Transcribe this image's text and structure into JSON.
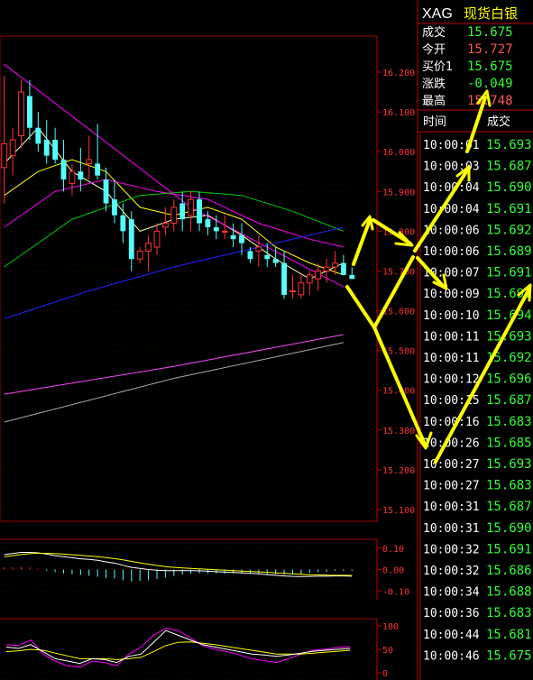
{
  "instrument": {
    "code": "XAG",
    "name": "现货白银"
  },
  "quote": [
    {
      "label": "成交",
      "value": "15.675",
      "color": "#33ff33"
    },
    {
      "label": "今开",
      "value": "15.727",
      "color": "#ff5555"
    },
    {
      "label": "买价1",
      "value": "15.675",
      "color": "#33ff33"
    },
    {
      "label": "涨跌",
      "value": "-0.049",
      "color": "#33ff33"
    },
    {
      "label": "最高",
      "value": "15.748",
      "color": "#ff5555"
    }
  ],
  "ticks_header": {
    "time": "时间",
    "price": "成交"
  },
  "ticks": [
    {
      "time": "10:00:01",
      "price": "15.693"
    },
    {
      "time": "10:00:03",
      "price": "15.687"
    },
    {
      "time": "10:00:04",
      "price": "15.690"
    },
    {
      "time": "10:00:04",
      "price": "15.691"
    },
    {
      "time": "10:00:06",
      "price": "15.692"
    },
    {
      "time": "10:00:06",
      "price": "15.689"
    },
    {
      "time": "10:00:07",
      "price": "15.691"
    },
    {
      "time": "10:00:09",
      "price": "15.691"
    },
    {
      "time": "10:00:10",
      "price": "15.694"
    },
    {
      "time": "10:00:11",
      "price": "15.693"
    },
    {
      "time": "10:00:11",
      "price": "15.692"
    },
    {
      "time": "10:00:12",
      "price": "15.696"
    },
    {
      "time": "10:00:15",
      "price": "15.687"
    },
    {
      "time": "10:00:16",
      "price": "15.683"
    },
    {
      "time": "10:00:26",
      "price": "15.685"
    },
    {
      "time": "10:00:27",
      "price": "15.693"
    },
    {
      "time": "10:00:27",
      "price": "15.683"
    },
    {
      "time": "10:00:31",
      "price": "15.687"
    },
    {
      "time": "10:00:31",
      "price": "15.690"
    },
    {
      "time": "10:00:32",
      "price": "15.691"
    },
    {
      "time": "10:00:32",
      "price": "15.686"
    },
    {
      "time": "10:00:34",
      "price": "15.688"
    },
    {
      "time": "10:00:36",
      "price": "15.683"
    },
    {
      "time": "10:00:44",
      "price": "15.681"
    },
    {
      "time": "10:00:46",
      "price": "15.675"
    }
  ],
  "price_axis": {
    "labels": [
      "16.200",
      "16.100",
      "16.000",
      "15.900",
      "15.800",
      "15.700",
      "15.600",
      "15.500",
      "15.400",
      "15.300",
      "15.200",
      "15.100"
    ],
    "max": 16.2,
    "min": 15.1
  },
  "candles": [
    {
      "o": 15.96,
      "h": 16.19,
      "l": 15.87,
      "c": 16.02
    },
    {
      "o": 15.99,
      "h": 16.06,
      "l": 15.94,
      "c": 16.03
    },
    {
      "o": 16.04,
      "h": 16.18,
      "l": 16.01,
      "c": 16.15
    },
    {
      "o": 16.14,
      "h": 16.18,
      "l": 16.03,
      "c": 16.06
    },
    {
      "o": 16.06,
      "h": 16.1,
      "l": 16.0,
      "c": 16.02
    },
    {
      "o": 16.03,
      "h": 16.08,
      "l": 15.97,
      "c": 15.99
    },
    {
      "o": 16.03,
      "h": 16.06,
      "l": 15.97,
      "c": 15.98
    },
    {
      "o": 15.98,
      "h": 16.03,
      "l": 15.9,
      "c": 15.93
    },
    {
      "o": 15.92,
      "h": 15.97,
      "l": 15.89,
      "c": 15.95
    },
    {
      "o": 15.95,
      "h": 16.01,
      "l": 15.9,
      "c": 15.93
    },
    {
      "o": 15.97,
      "h": 16.04,
      "l": 15.93,
      "c": 15.98
    },
    {
      "o": 15.97,
      "h": 16.07,
      "l": 15.93,
      "c": 15.94
    },
    {
      "o": 15.93,
      "h": 15.96,
      "l": 15.85,
      "c": 15.87
    },
    {
      "o": 15.88,
      "h": 15.93,
      "l": 15.82,
      "c": 15.84
    },
    {
      "o": 15.84,
      "h": 15.87,
      "l": 15.77,
      "c": 15.8
    },
    {
      "o": 15.83,
      "h": 15.85,
      "l": 15.7,
      "c": 15.73
    },
    {
      "o": 15.73,
      "h": 15.76,
      "l": 15.72,
      "c": 15.75
    },
    {
      "o": 15.75,
      "h": 15.79,
      "l": 15.7,
      "c": 15.77
    },
    {
      "o": 15.76,
      "h": 15.82,
      "l": 15.74,
      "c": 15.8
    },
    {
      "o": 15.81,
      "h": 15.86,
      "l": 15.79,
      "c": 15.82
    },
    {
      "o": 15.82,
      "h": 15.88,
      "l": 15.8,
      "c": 15.86
    },
    {
      "o": 15.87,
      "h": 15.9,
      "l": 15.8,
      "c": 15.83
    },
    {
      "o": 15.84,
      "h": 15.9,
      "l": 15.8,
      "c": 15.88
    },
    {
      "o": 15.88,
      "h": 15.9,
      "l": 15.8,
      "c": 15.82
    },
    {
      "o": 15.83,
      "h": 15.85,
      "l": 15.79,
      "c": 15.81
    },
    {
      "o": 15.81,
      "h": 15.84,
      "l": 15.78,
      "c": 15.8
    },
    {
      "o": 15.8,
      "h": 15.84,
      "l": 15.78,
      "c": 15.8
    },
    {
      "o": 15.79,
      "h": 15.82,
      "l": 15.76,
      "c": 15.78
    },
    {
      "o": 15.79,
      "h": 15.82,
      "l": 15.74,
      "c": 15.77
    },
    {
      "o": 15.75,
      "h": 15.76,
      "l": 15.72,
      "c": 15.73
    },
    {
      "o": 15.75,
      "h": 15.79,
      "l": 15.71,
      "c": 15.76
    },
    {
      "o": 15.74,
      "h": 15.77,
      "l": 15.71,
      "c": 15.73
    },
    {
      "o": 15.73,
      "h": 15.76,
      "l": 15.71,
      "c": 15.72
    },
    {
      "o": 15.72,
      "h": 15.75,
      "l": 15.63,
      "c": 15.64
    },
    {
      "o": 15.65,
      "h": 15.69,
      "l": 15.63,
      "c": 15.65
    },
    {
      "o": 15.64,
      "h": 15.69,
      "l": 15.63,
      "c": 15.67
    },
    {
      "o": 15.67,
      "h": 15.7,
      "l": 15.64,
      "c": 15.69
    },
    {
      "o": 15.68,
      "h": 15.72,
      "l": 15.65,
      "c": 15.7
    },
    {
      "o": 15.7,
      "h": 15.73,
      "l": 15.67,
      "c": 15.71
    },
    {
      "o": 15.71,
      "h": 15.75,
      "l": 15.69,
      "c": 15.72
    },
    {
      "o": 15.72,
      "h": 15.74,
      "l": 15.69,
      "c": 15.69
    },
    {
      "o": 15.69,
      "h": 15.71,
      "l": 15.68,
      "c": 15.68
    }
  ],
  "ma_lines": [
    {
      "color": "#ffffaa",
      "points": [
        [
          0,
          15.97
        ],
        [
          4,
          16.06
        ],
        [
          8,
          15.95
        ],
        [
          12,
          15.9
        ],
        [
          16,
          15.8
        ],
        [
          20,
          15.83
        ],
        [
          24,
          15.84
        ],
        [
          28,
          15.79
        ],
        [
          32,
          15.73
        ],
        [
          36,
          15.68
        ],
        [
          40,
          15.72
        ]
      ]
    },
    {
      "color": "#ffff00",
      "points": [
        [
          0,
          15.89
        ],
        [
          4,
          15.95
        ],
        [
          8,
          15.98
        ],
        [
          12,
          15.95
        ],
        [
          16,
          15.86
        ],
        [
          20,
          15.84
        ],
        [
          24,
          15.86
        ],
        [
          28,
          15.83
        ],
        [
          32,
          15.76
        ],
        [
          36,
          15.72
        ],
        [
          40,
          15.69
        ]
      ]
    },
    {
      "color": "#ff00ff",
      "points": [
        [
          0,
          15.81
        ],
        [
          6,
          15.9
        ],
        [
          12,
          15.93
        ],
        [
          18,
          15.9
        ],
        [
          24,
          15.88
        ],
        [
          30,
          15.82
        ],
        [
          36,
          15.78
        ],
        [
          40,
          15.76
        ]
      ]
    },
    {
      "color": "#00cc00",
      "points": [
        [
          0,
          15.71
        ],
        [
          8,
          15.83
        ],
        [
          16,
          15.89
        ],
        [
          22,
          15.9
        ],
        [
          28,
          15.89
        ],
        [
          34,
          15.85
        ],
        [
          40,
          15.8
        ]
      ]
    },
    {
      "color": "#2222ff",
      "points": [
        [
          0,
          15.58
        ],
        [
          10,
          15.65
        ],
        [
          20,
          15.71
        ],
        [
          30,
          15.76
        ],
        [
          40,
          15.81
        ]
      ]
    },
    {
      "color": "#ff44ff",
      "points": [
        [
          0,
          15.39
        ],
        [
          20,
          15.46
        ],
        [
          40,
          15.54
        ]
      ]
    },
    {
      "color": "#aaaaaa",
      "points": [
        [
          0,
          15.32
        ],
        [
          20,
          15.43
        ],
        [
          40,
          15.52
        ]
      ]
    }
  ],
  "trend_line": {
    "color": "#ff00ff",
    "points": [
      [
        0,
        16.22
      ],
      [
        22,
        15.86
      ],
      [
        40,
        15.66
      ]
    ]
  },
  "macd_axis": {
    "labels": [
      "0.10",
      "0.00",
      "-0.10"
    ],
    "max": 0.12,
    "min": -0.12
  },
  "macd": {
    "dif": [
      0.07,
      0.075,
      0.08,
      0.08,
      0.078,
      0.072,
      0.065,
      0.06,
      0.055,
      0.05,
      0.047,
      0.043,
      0.036,
      0.03,
      0.02,
      0.01,
      0.005,
      0.0,
      -0.003,
      -0.005,
      -0.005,
      -0.005,
      -0.005,
      -0.006,
      -0.008,
      -0.01,
      -0.012,
      -0.014,
      -0.016,
      -0.018,
      -0.02,
      -0.024,
      -0.027,
      -0.03,
      -0.032,
      -0.033,
      -0.032,
      -0.031,
      -0.031,
      -0.03,
      -0.03,
      -0.031
    ],
    "dea": [
      0.06,
      0.065,
      0.07,
      0.074,
      0.076,
      0.076,
      0.074,
      0.072,
      0.069,
      0.066,
      0.063,
      0.06,
      0.056,
      0.051,
      0.045,
      0.038,
      0.031,
      0.025,
      0.019,
      0.014,
      0.01,
      0.007,
      0.005,
      0.003,
      0.001,
      -0.001,
      -0.003,
      -0.005,
      -0.007,
      -0.009,
      -0.011,
      -0.013,
      -0.016,
      -0.018,
      -0.02,
      -0.022,
      -0.024,
      -0.025,
      -0.026,
      -0.027,
      -0.027,
      -0.028
    ],
    "hist": [
      0.01,
      0.01,
      0.012,
      0.01,
      0.004,
      -0.006,
      -0.012,
      -0.018,
      -0.022,
      -0.026,
      -0.03,
      -0.034,
      -0.04,
      -0.042,
      -0.05,
      -0.056,
      -0.052,
      -0.05,
      -0.044,
      -0.038,
      -0.03,
      -0.024,
      -0.02,
      -0.018,
      -0.018,
      -0.018,
      -0.018,
      -0.018,
      -0.018,
      -0.018,
      -0.018,
      -0.022,
      -0.022,
      -0.024,
      -0.024,
      -0.022,
      -0.016,
      -0.012,
      -0.01,
      -0.006,
      -0.006,
      -0.006
    ]
  },
  "kdj_axis": {
    "labels": [
      "100",
      "50",
      "0"
    ],
    "max": 100,
    "min": 0
  },
  "kdj": {
    "k": [
      55,
      52,
      60,
      45,
      30,
      25,
      20,
      30,
      28,
      22,
      35,
      40,
      65,
      90,
      80,
      70,
      60,
      55,
      50,
      45,
      40,
      38,
      35,
      38,
      42,
      46,
      48,
      50,
      52
    ],
    "d": [
      45,
      47,
      50,
      48,
      42,
      36,
      30,
      30,
      30,
      28,
      30,
      33,
      45,
      58,
      65,
      66,
      63,
      60,
      56,
      52,
      48,
      44,
      40,
      40,
      40,
      42,
      44,
      46,
      48
    ],
    "j": [
      60,
      58,
      70,
      40,
      25,
      15,
      12,
      25,
      22,
      15,
      40,
      55,
      80,
      95,
      90,
      75,
      58,
      50,
      45,
      38,
      30,
      26,
      22,
      30,
      40,
      48,
      50,
      54,
      56
    ]
  },
  "annotation": {
    "color": "#ffff00"
  }
}
